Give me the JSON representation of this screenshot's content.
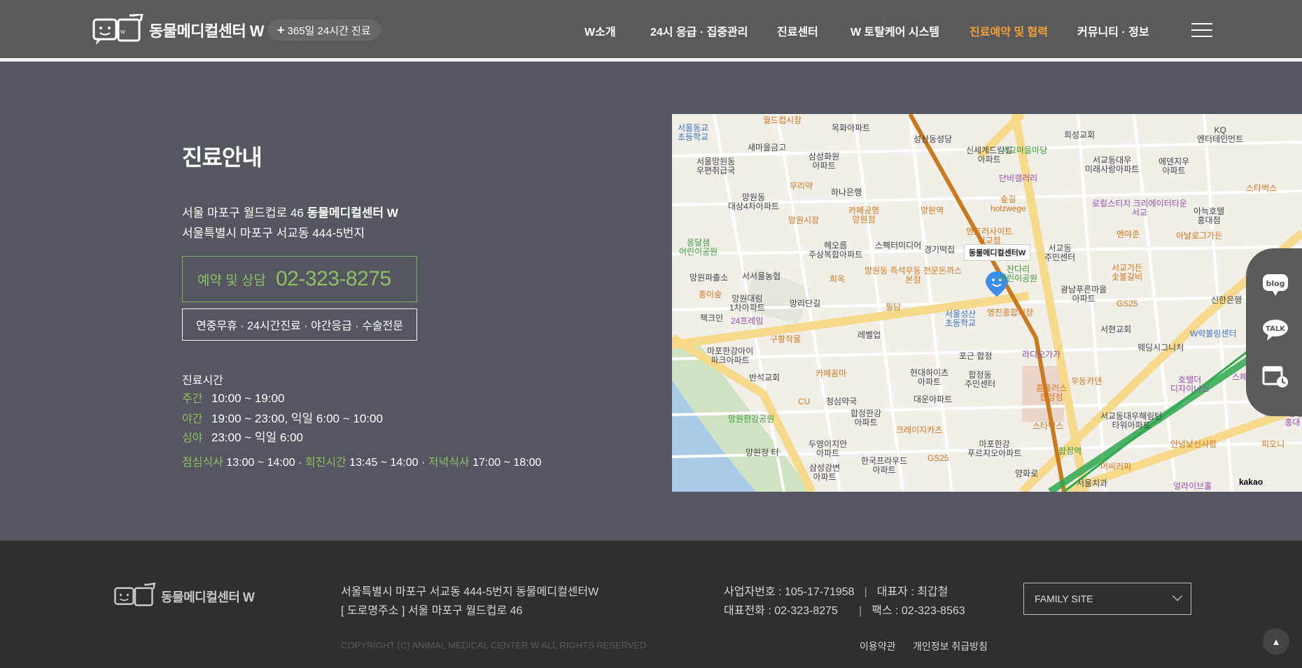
{
  "header": {
    "logo_text": "동물메디컬센터 W",
    "badge_text": "365일 24시간 진료",
    "nav": [
      {
        "label": "W소개",
        "active": false
      },
      {
        "label": "24시 응급 · 집중관리",
        "active": false
      },
      {
        "label": "진료센터",
        "active": false
      },
      {
        "label": "W 토탈케어 시스템",
        "active": false
      },
      {
        "label": "진료예약 및 협력",
        "active": true
      },
      {
        "label": "커뮤니티 · 정보",
        "active": false
      }
    ],
    "menu_icon": "hamburger-icon"
  },
  "info": {
    "title": "진료안내",
    "address_line1_prefix": "서울 마포구 월드컵로 46 ",
    "address_line1_bold": "동물메디컬센터 W",
    "address_line2": "서울특별시 마포구 서교동 444-5번지",
    "call_label": "예약 및 상담",
    "call_number": "02-323-8275",
    "tagline": "연중무휴 · 24시간진료 · 야간응급 · 수술전문",
    "hours_title": "진료시간",
    "hours": [
      {
        "label": "주간",
        "time": "10:00 ~ 19:00"
      },
      {
        "label": "야간",
        "time": "19:00 ~ 23:00, 익일 6:00 ~ 10:00"
      },
      {
        "label": "심야",
        "time": "23:00 ~ 익일 6:00"
      }
    ],
    "meals": [
      {
        "label": "점심식사",
        "time": "13:00 ~ 14:00"
      },
      {
        "label": "회진시간",
        "time": "13:45 ~ 14:00"
      },
      {
        "label": "저녁식사",
        "time": "17:00 ~ 18:00"
      }
    ]
  },
  "map": {
    "pin_label": "동물메디컬센터W",
    "attribution": "kakao",
    "labels": [
      {
        "t": "서울동교\n초등학교",
        "c": "b"
      },
      {
        "t": "월드컵시장",
        "c": "o"
      },
      {
        "t": "목화아파트",
        "c": ""
      },
      {
        "t": "성산동성당",
        "c": ""
      },
      {
        "t": "새마을금고",
        "c": ""
      },
      {
        "t": "서울망원동\n우편취급국",
        "c": ""
      },
      {
        "t": "삼성화원\n아파트",
        "c": ""
      },
      {
        "t": "신세계드림빌\n아파트",
        "c": ""
      },
      {
        "t": "단비갤러리",
        "c": "p"
      },
      {
        "t": "서교마을마당",
        "c": "gr"
      },
      {
        "t": "희성교회",
        "c": ""
      },
      {
        "t": "서교동대우\n미래사랑아파트",
        "c": ""
      },
      {
        "t": "KQ\n엔터테인먼트",
        "c": ""
      },
      {
        "t": "망원동\n대상4차아파트",
        "c": ""
      },
      {
        "t": "우리약",
        "c": "o"
      },
      {
        "t": "하나은행",
        "c": ""
      },
      {
        "t": "에덴지우\n아파트",
        "c": ""
      },
      {
        "t": "로컬스티치 크리에이터타운\n서교",
        "c": "p"
      },
      {
        "t": "망원시장",
        "c": "o"
      },
      {
        "t": "카페공명\n망원점",
        "c": "o"
      },
      {
        "t": "망원역",
        "c": "o"
      },
      {
        "t": "숲길\nholzwege",
        "c": "o"
      },
      {
        "t": "앤트러사이트\n서교점",
        "c": "o"
      },
      {
        "t": "아늑호텔\n홍대점",
        "c": ""
      },
      {
        "t": "스타벅스",
        "c": "o"
      },
      {
        "t": "옹달샘\n어린이공원",
        "c": "gr"
      },
      {
        "t": "헤오름\n주상복합아파트",
        "c": ""
      },
      {
        "t": "스펙터미디어",
        "c": ""
      },
      {
        "t": "경기떡집",
        "c": ""
      },
      {
        "t": "서교동\n주민센터",
        "c": ""
      },
      {
        "t": "멘야준",
        "c": "o"
      },
      {
        "t": "아날로그가든",
        "c": "o"
      },
      {
        "t": "망원파출소",
        "c": ""
      },
      {
        "t": "서서울농협",
        "c": ""
      },
      {
        "t": "희옥",
        "c": "o"
      },
      {
        "t": "망원동 즉석우동 전문돈까스\n본점",
        "c": "o"
      },
      {
        "t": "잔다리\n어린이공원",
        "c": "gr"
      },
      {
        "t": "서교가든\n숯불갈비",
        "c": "o"
      },
      {
        "t": "광남푸른마을\n아파트",
        "c": ""
      },
      {
        "t": "GS25",
        "c": "o"
      },
      {
        "t": "신한은행",
        "c": ""
      },
      {
        "t": "종이숲",
        "c": "o"
      },
      {
        "t": "망원대림\n1차아파트",
        "c": ""
      },
      {
        "t": "망리단길",
        "c": ""
      },
      {
        "t": "필담",
        "c": "o"
      },
      {
        "t": "서울성산\n초등학교",
        "c": "b"
      },
      {
        "t": "영진종합시장",
        "c": "o"
      },
      {
        "t": "서현교회",
        "c": ""
      },
      {
        "t": "W락볼링센터",
        "c": "b"
      },
      {
        "t": "책크인",
        "c": ""
      },
      {
        "t": "24프레임",
        "c": "p"
      },
      {
        "t": "레벨업",
        "c": ""
      },
      {
        "t": "웨딩시그니처",
        "c": ""
      },
      {
        "t": "구황작물",
        "c": "o"
      },
      {
        "t": "포근 합정",
        "c": ""
      },
      {
        "t": "라디오가가",
        "c": "p"
      },
      {
        "t": "마포한강아이\n파크아파트",
        "c": ""
      },
      {
        "t": "반석교회",
        "c": ""
      },
      {
        "t": "카페꼼마",
        "c": "o"
      },
      {
        "t": "현대하이츠\n아파트",
        "c": ""
      },
      {
        "t": "합정동\n주민센터",
        "c": ""
      },
      {
        "t": "우동카덴",
        "c": "o"
      },
      {
        "t": "호텔더\n디자이너스",
        "c": "p"
      },
      {
        "t": "스페이스볼링",
        "c": "p"
      },
      {
        "t": "CU",
        "c": "o"
      },
      {
        "t": "청심약국",
        "c": ""
      },
      {
        "t": "대운아파트",
        "c": ""
      },
      {
        "t": "홈플러스\n합정점",
        "c": "o"
      },
      {
        "t": "서교동대우해링턴\n타워아파트",
        "c": ""
      },
      {
        "t": "KT&G상상마당\n홍대",
        "c": "p"
      },
      {
        "t": "합정한강\n아파트",
        "c": ""
      },
      {
        "t": "크레이지카츠",
        "c": "o"
      },
      {
        "t": "스타벅스",
        "c": "o"
      },
      {
        "t": "두영이지안\n아파트",
        "c": ""
      },
      {
        "t": "망원정 터",
        "c": ""
      },
      {
        "t": "마포한강\n푸르지오아파트",
        "c": ""
      },
      {
        "t": "합정역",
        "c": "gr"
      },
      {
        "t": "안녕낯선사람",
        "c": "o"
      },
      {
        "t": "피오니",
        "c": "o"
      },
      {
        "t": "한국프라우드\n아파트",
        "c": ""
      },
      {
        "t": "GS25",
        "c": "o"
      },
      {
        "t": "삼성강변\n아파트",
        "c": ""
      },
      {
        "t": "머씨커피",
        "c": "o"
      },
      {
        "t": "서울치과",
        "c": ""
      },
      {
        "t": "얼라이브홀",
        "c": "p"
      },
      {
        "t": "망원한강공원",
        "c": "gr"
      },
      {
        "t": "양화로",
        "c": ""
      }
    ]
  },
  "side_buttons": [
    {
      "name": "blog-button",
      "text": "blog"
    },
    {
      "name": "talk-button",
      "text": "TALK"
    },
    {
      "name": "schedule-button",
      "text": ""
    }
  ],
  "footer": {
    "logo_text": "동물메디컬센터 W",
    "address": "서울특별시 마포구 서교동 444-5번지 동물메디컬센터W",
    "road_address": "[ 도로명주소 ] 서울 마포구 월드컵로 46",
    "biz_no": "사업자번호 : 105-17-71958",
    "ceo": "대표자 : 최갑철",
    "phone": "대표전화 : 02-323-8275",
    "fax": "팩스 : 02-323-8563",
    "family_site": "FAMILY SITE",
    "copyright": "COPYRIGHT (C) ANIMAL MEDICAL CENTER W ALL RIGHTS RESERVED",
    "terms": "이용약관",
    "privacy": "개인정보 취급방침"
  },
  "colors": {
    "header_bg": "#5a5a5b",
    "body_bg": "#545760",
    "accent_green": "#8ebf65",
    "active_nav": "#f0a035",
    "footer_bg": "#2f2f30"
  }
}
